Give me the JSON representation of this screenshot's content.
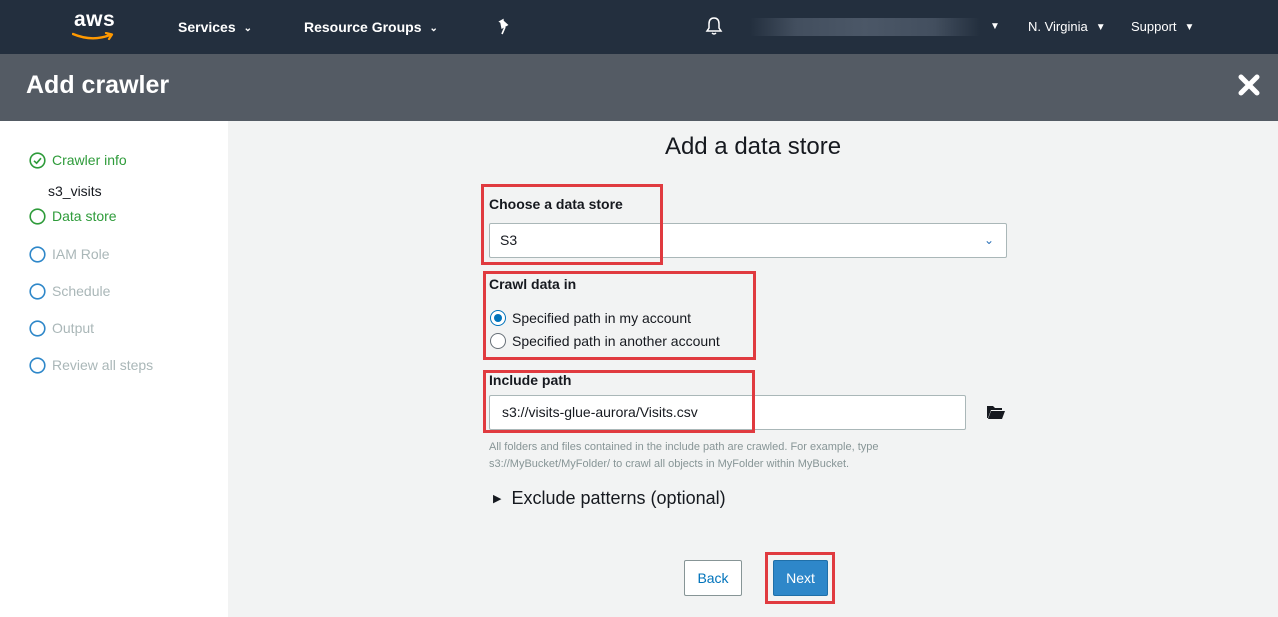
{
  "nav": {
    "logo_text": "aws",
    "services": "Services",
    "resource_groups": "Resource Groups",
    "region": "N. Virginia",
    "support": "Support"
  },
  "header": {
    "title": "Add crawler"
  },
  "sidebar": {
    "steps": [
      {
        "label": "Crawler info",
        "state": "done",
        "sub": "s3_visits"
      },
      {
        "label": "Data store",
        "state": "current"
      },
      {
        "label": "IAM Role",
        "state": "future"
      },
      {
        "label": "Schedule",
        "state": "future"
      },
      {
        "label": "Output",
        "state": "future"
      },
      {
        "label": "Review all steps",
        "state": "future"
      }
    ]
  },
  "main": {
    "title": "Add a data store",
    "data_store_label": "Choose a data store",
    "data_store_value": "S3",
    "crawl_label": "Crawl data in",
    "crawl_options": [
      {
        "label": "Specified path in my account",
        "checked": true
      },
      {
        "label": "Specified path in another account",
        "checked": false
      }
    ],
    "include_label": "Include path",
    "include_value": "s3://visits-glue-aurora/Visits.csv",
    "help_text_1": "All folders and files contained in the include path are crawled. For example, type",
    "help_text_2": "s3://MyBucket/MyFolder/ to crawl all objects in MyFolder within MyBucket.",
    "exclude_label": "Exclude patterns (optional)",
    "back_label": "Back",
    "next_label": "Next"
  },
  "colors": {
    "nav_bg": "#232f3e",
    "header_bg": "#545b64",
    "main_bg": "#f2f3f3",
    "step_active": "#2e9b3a",
    "step_future": "#aab7b8",
    "primary": "#2e87c9",
    "highlight": "#e03a3f"
  }
}
